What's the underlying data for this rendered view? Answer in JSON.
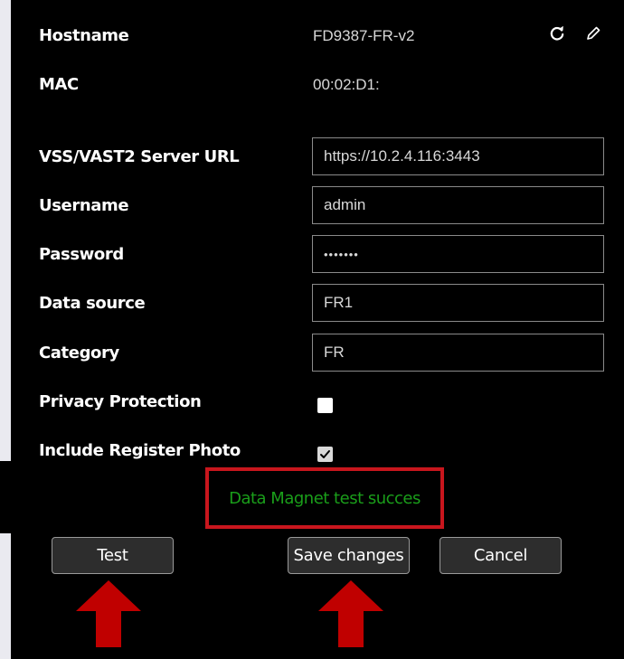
{
  "device": {
    "hostname_label": "Hostname",
    "hostname_value": "FD9387-FR-v2",
    "mac_label": "MAC",
    "mac_value": "00:02:D1:"
  },
  "icons": {
    "refresh": "refresh-icon",
    "edit": "pencil-icon"
  },
  "form": {
    "server_url_label": "VSS/VAST2 Server URL",
    "server_url_value": "https://10.2.4.116:3443",
    "username_label": "Username",
    "username_value": "admin",
    "password_label": "Password",
    "password_value": "•••••••",
    "data_source_label": "Data source",
    "data_source_value": "FR1",
    "category_label": "Category",
    "category_value": "FR",
    "privacy_label": "Privacy Protection",
    "privacy_checked": false,
    "register_photo_label": "Include Register Photo",
    "register_photo_checked": true
  },
  "status": {
    "message": "Data Magnet test succes",
    "color": "#1a9e1a",
    "highlight_color": "#c8161d"
  },
  "buttons": {
    "test": "Test",
    "save": "Save changes",
    "cancel": "Cancel"
  },
  "annotations": {
    "arrow_color": "#c00000"
  }
}
